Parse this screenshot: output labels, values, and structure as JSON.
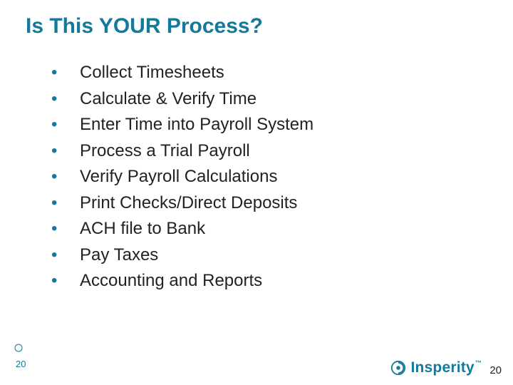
{
  "title": "Is This YOUR Process?",
  "bullets": [
    "Collect Timesheets",
    "Calculate & Verify Time",
    "Enter Time into Payroll System",
    "Process a Trial Payroll",
    "Verify Payroll Calculations",
    "Print Checks/Direct Deposits",
    "ACH file to Bank",
    "Pay Taxes",
    "Accounting and Reports"
  ],
  "page_number_left": "20",
  "page_number_right": "20",
  "logo_text": "Insperity",
  "logo_trademark": "™",
  "brand_color": "#147a9c"
}
